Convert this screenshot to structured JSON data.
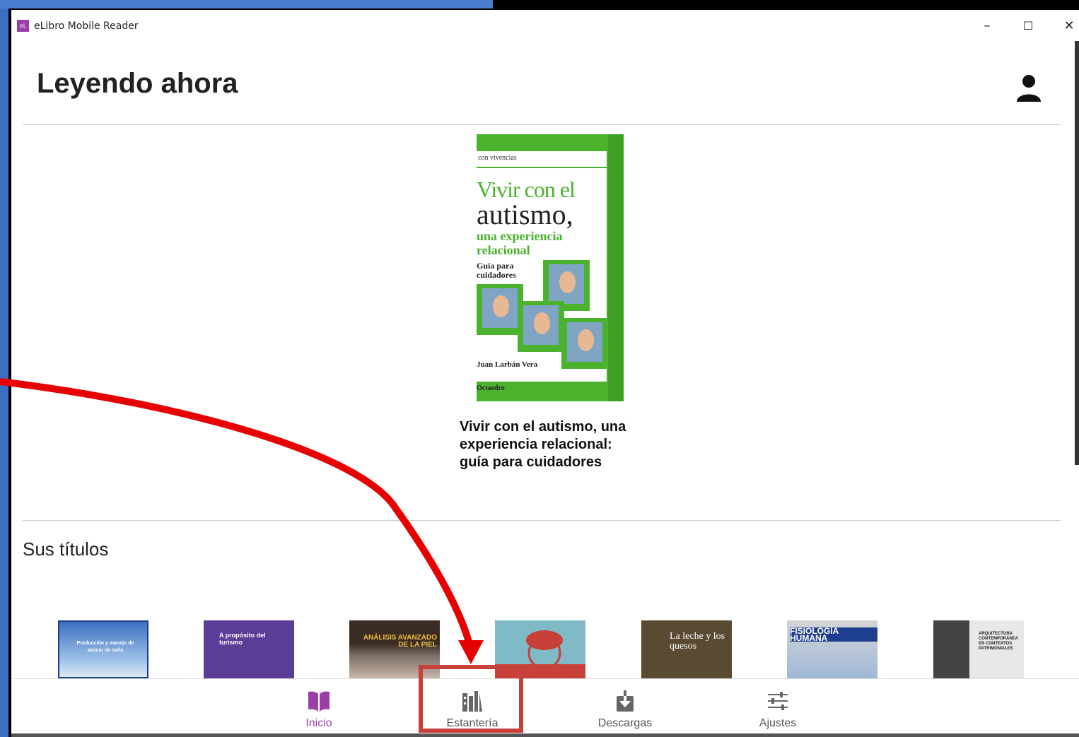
{
  "window": {
    "app_title": "eLibro Mobile Reader",
    "app_icon_text": "eL",
    "minimize": "–",
    "maximize": "☐",
    "close": "✕"
  },
  "header": {
    "title": "Leyendo ahora"
  },
  "current_book": {
    "cover": {
      "series": "con vivencias",
      "title_line1": "Vivir con el",
      "title_line2": "autismo,",
      "subtitle_line1": "una experiencia",
      "subtitle_line2": "relacional",
      "guide": "Guía para cuidadores",
      "author": "Juan Larbán Vera",
      "publisher": "Octaedro"
    },
    "title": "Vivir con el autismo, una experiencia relacional: guía para cuidadores"
  },
  "titles_section": {
    "heading": "Sus títulos",
    "books": [
      {
        "text": "Producción y manejo de azúcar de caña"
      },
      {
        "text": "A propósito del turismo"
      },
      {
        "text": "ANÁLISIS AVANZADO DE LA PIEL"
      },
      {
        "text": ""
      },
      {
        "text": "La leche y los quesos"
      },
      {
        "text": "FISIOLOGÍA HUMANA"
      },
      {
        "text": "ARQUITECTURA CONTEMPORÁNEA EN CONTEXTOS PATRIMONIALES"
      }
    ]
  },
  "bottom_nav": {
    "items": [
      {
        "label": "Inicio"
      },
      {
        "label": "Estantería"
      },
      {
        "label": "Descargas"
      },
      {
        "label": "Ajustes"
      }
    ]
  },
  "colors": {
    "accent": "#9b3ea8",
    "annotation": "#e60000",
    "highlight_box": "#c8403a",
    "cover_green": "#4bb22d"
  }
}
